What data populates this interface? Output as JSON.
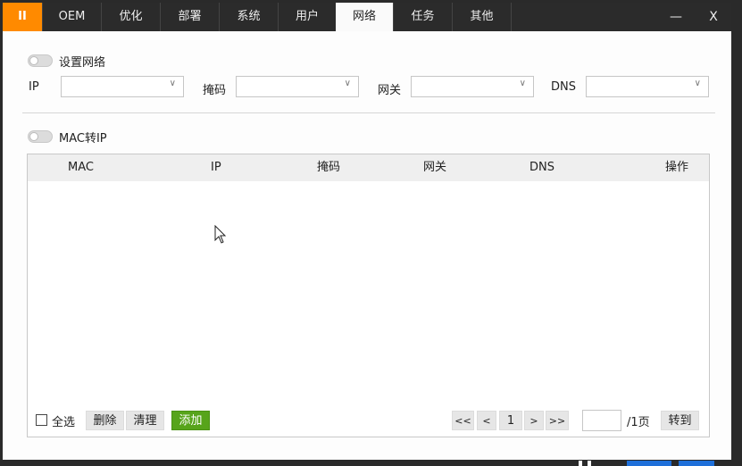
{
  "titlebar": {
    "logo_label": "II",
    "tabs": [
      {
        "label": "OEM"
      },
      {
        "label": "优化"
      },
      {
        "label": "部署"
      },
      {
        "label": "系统"
      },
      {
        "label": "用户"
      },
      {
        "label": "网络",
        "active": true
      },
      {
        "label": "任务"
      },
      {
        "label": "其他"
      }
    ],
    "minimize_label": "—",
    "close_label": "X"
  },
  "network": {
    "switch_label": "设置网络",
    "switch_on": false,
    "fields": {
      "ip_label": "IP",
      "mask_label": "掩码",
      "gateway_label": "网关",
      "dns_label": "DNS",
      "ip_value": "",
      "mask_value": "",
      "gateway_value": "",
      "dns_value": ""
    }
  },
  "mac_to_ip": {
    "switch_label": "MAC转IP",
    "switch_on": false
  },
  "table": {
    "columns": [
      "MAC",
      "IP",
      "掩码",
      "网关",
      "DNS",
      "操作"
    ],
    "rows": []
  },
  "footer": {
    "select_all_label": "全选",
    "select_all_checked": false,
    "delete_label": "删除",
    "clear_label": "清理",
    "add_label": "添加",
    "first_label": "<<",
    "prev_label": "<",
    "current_page": "1",
    "next_label": ">",
    "last_label": ">>",
    "page_input_value": "",
    "total_label": "/1页",
    "goto_label": "转到"
  },
  "colors": {
    "accent_orange": "#ff8a00",
    "add_green": "#57a41b",
    "titlebar": "#2b2b2b"
  }
}
